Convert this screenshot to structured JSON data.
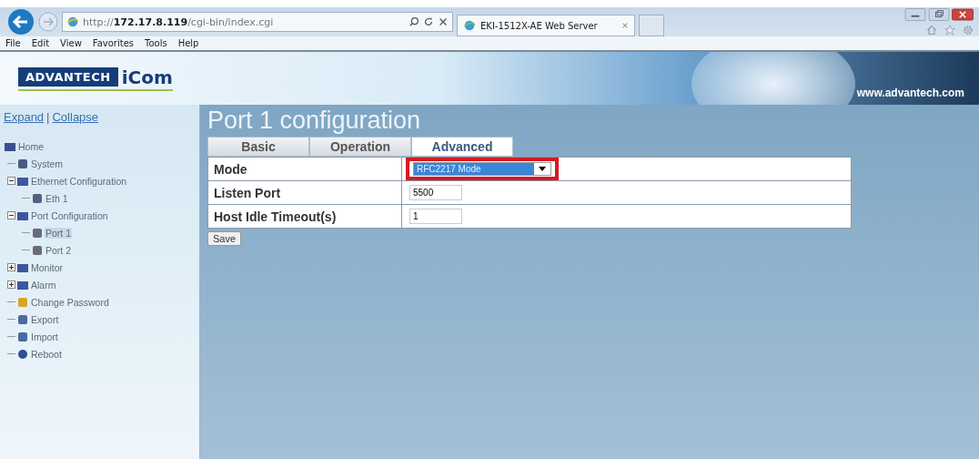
{
  "browser": {
    "address": "http://**172.17.8.119**/cgi-bin/index.cgi",
    "tab_title": "EKI-1512X-AE Web Server",
    "menu": [
      "File",
      "Edit",
      "View",
      "Favorites",
      "Tools",
      "Help"
    ]
  },
  "banner": {
    "logo_brand": "ADVANTECH",
    "logo_product": "iCom",
    "url": "www.advantech.com"
  },
  "sidebar": {
    "expand": "Expand",
    "separator": "|",
    "collapse": "Collapse",
    "tree": [
      {
        "label": "Home",
        "kind": "home",
        "selected": false,
        "children": [
          {
            "label": "System",
            "kind": "system",
            "selected": false
          },
          {
            "label": "Ethernet Configuration",
            "kind": "folder",
            "expanded": true,
            "selected": false,
            "children": [
              {
                "label": "Eth 1",
                "kind": "eth",
                "selected": false
              }
            ]
          },
          {
            "label": "Port Configuration",
            "kind": "folder",
            "expanded": true,
            "selected": false,
            "children": [
              {
                "label": "Port 1",
                "kind": "port",
                "selected": true
              },
              {
                "label": "Port 2",
                "kind": "port",
                "selected": false
              }
            ]
          },
          {
            "label": "Monitor",
            "kind": "folder",
            "expanded": false,
            "selected": false
          },
          {
            "label": "Alarm",
            "kind": "folder",
            "expanded": false,
            "selected": false
          },
          {
            "label": "Change Password",
            "kind": "password",
            "selected": false
          },
          {
            "label": "Export",
            "kind": "export",
            "selected": false
          },
          {
            "label": "Import",
            "kind": "import",
            "selected": false
          },
          {
            "label": "Reboot",
            "kind": "reboot",
            "selected": false
          }
        ]
      }
    ]
  },
  "page": {
    "title": "Port 1 configuration",
    "tabs": [
      {
        "label": "Basic",
        "selected": false
      },
      {
        "label": "Operation",
        "selected": false
      },
      {
        "label": "Advanced",
        "selected": true
      }
    ],
    "rows": [
      {
        "label": "Mode",
        "kind": "select",
        "value": "RFC2217 Mode",
        "highlighted": true
      },
      {
        "label": "Listen Port",
        "kind": "input",
        "value": "5500",
        "highlighted": false
      },
      {
        "label": "Host Idle Timeout(s)",
        "kind": "input",
        "value": "1",
        "highlighted": false
      }
    ],
    "save": "Save"
  }
}
